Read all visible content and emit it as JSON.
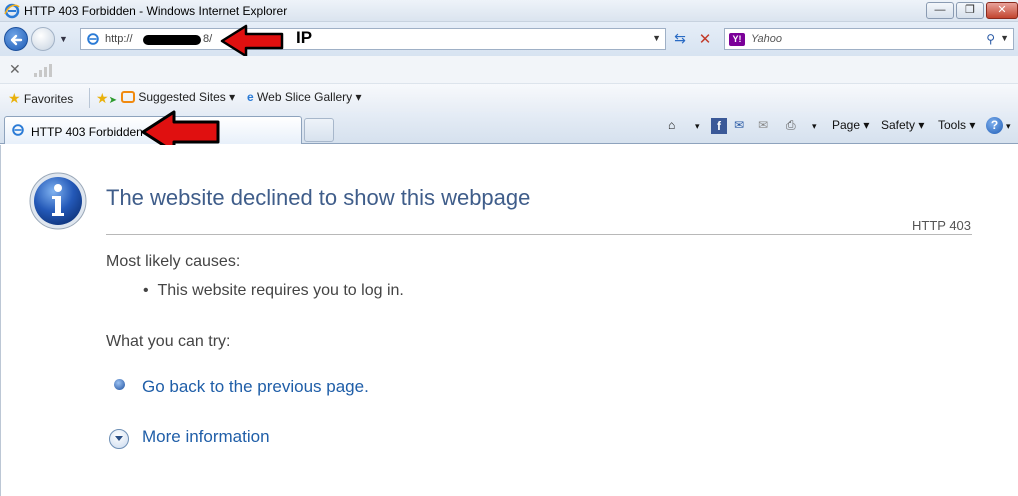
{
  "window": {
    "title": "HTTP 403 Forbidden - Windows Internet Explorer",
    "min_label": "—",
    "max_label": "❐",
    "close_label": "✕"
  },
  "address": {
    "url_prefix": "http://",
    "url_suffix": "8/",
    "dropdown": "▼"
  },
  "search": {
    "placeholder": "Yahoo",
    "provider_badge": "Y!"
  },
  "annotation": {
    "ip_label": "IP"
  },
  "favorites_bar": {
    "favorites_label": "Favorites",
    "suggested_sites_label": "Suggested Sites",
    "web_slice_label": "Web Slice Gallery",
    "dropdown": "▾"
  },
  "tab": {
    "label": "HTTP 403 Forbidden"
  },
  "command_bar": {
    "page_label": "Page",
    "safety_label": "Safety",
    "tools_label": "Tools",
    "dropdown": "▾",
    "help_glyph": "?"
  },
  "content": {
    "headline": "The website declined to show this webpage",
    "status_code": "HTTP 403",
    "causes_heading": "Most likely causes:",
    "cause_item": "This website requires you to log in.",
    "try_heading": "What you can try:",
    "back_link": "Go back to the previous page.",
    "more_info_link": "More information"
  }
}
